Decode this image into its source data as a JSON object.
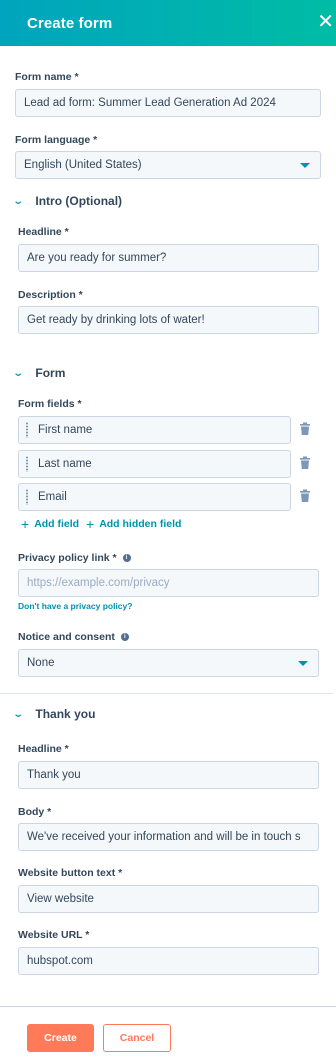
{
  "header": {
    "title": "Create form",
    "close_icon": "close-icon"
  },
  "form_name": {
    "label": "Form name *",
    "value": "Lead ad form: Summer Lead Generation Ad 2024"
  },
  "form_language": {
    "label": "Form language *",
    "value": "English (United States)"
  },
  "intro": {
    "section_title": "Intro (Optional)",
    "headline_label": "Headline *",
    "headline_value": "Are you ready for summer?",
    "description_label": "Description *",
    "description_value": "Get ready by drinking lots of water!"
  },
  "form": {
    "section_title": "Form",
    "fields_label": "Form fields *",
    "fields": [
      {
        "label": "First name"
      },
      {
        "label": "Last name"
      },
      {
        "label": "Email"
      }
    ],
    "add_field": "Add field",
    "add_hidden_field": "Add hidden field",
    "privacy_label": "Privacy policy link *",
    "privacy_placeholder": "https://example.com/privacy",
    "privacy_help": "Don't have a privacy policy?",
    "notice_label": "Notice and consent",
    "notice_value": "None"
  },
  "thank_you": {
    "section_title": "Thank you",
    "headline_label": "Headline *",
    "headline_value": "Thank you",
    "body_label": "Body *",
    "body_value": "We've received your information and will be in touch s",
    "button_text_label": "Website button text *",
    "button_text_value": "View website",
    "url_label": "Website URL *",
    "url_value": "hubspot.com"
  },
  "footer": {
    "create_label": "Create",
    "cancel_label": "Cancel"
  },
  "colors": {
    "accent": "#0091ae",
    "primary_button": "#ff7a59",
    "header_start": "#00a4bd",
    "header_end": "#00bda5"
  }
}
